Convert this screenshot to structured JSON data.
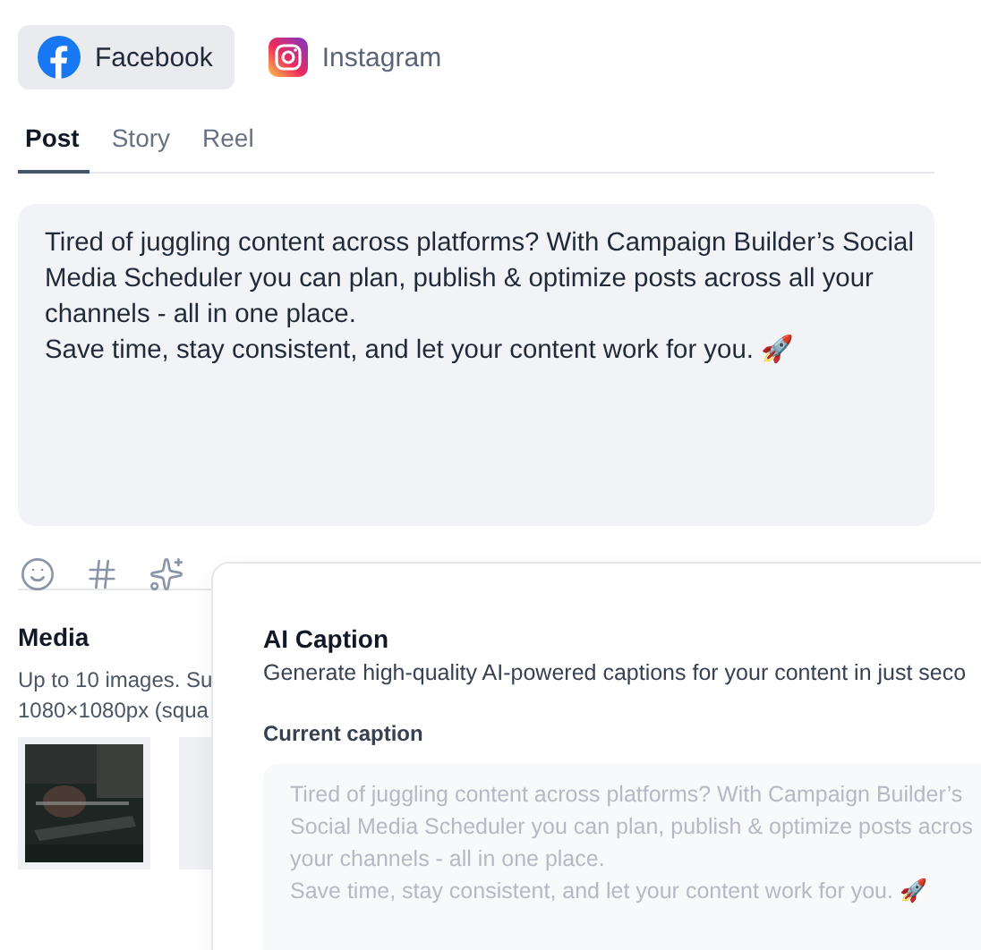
{
  "platforms": [
    {
      "kind": "facebook",
      "label": "Facebook",
      "selected": true
    },
    {
      "kind": "instagram",
      "label": "Instagram",
      "selected": false
    }
  ],
  "tabs": [
    {
      "label": "Post",
      "selected": true
    },
    {
      "label": "Story",
      "selected": false
    },
    {
      "label": "Reel",
      "selected": false
    }
  ],
  "post_text": "Tired of juggling content across platforms? With Campaign Builder’s Social Media Scheduler you can plan, publish & optimize posts across all your channels - all in one place.\nSave time, stay consistent, and let your content work for you. 🚀",
  "toolbar": [
    {
      "kind": "emoji"
    },
    {
      "kind": "hashtag"
    },
    {
      "kind": "ai"
    }
  ],
  "media": {
    "title": "Media",
    "description_lines": [
      "Up to 10 images. Su",
      "1080×1080px (squa"
    ],
    "items": [
      {
        "kind": "picture"
      },
      {
        "kind": "placeholder"
      }
    ]
  },
  "ai_caption": {
    "title": "AI Caption",
    "subtitle": "Generate high-quality AI-powered captions for your content in just seco",
    "label": "Current caption",
    "caption_lines": [
      "Tired of juggling content across platforms? With Campaign Builder’s",
      "Social Media Scheduler you can plan, publish & optimize posts acros",
      "your channels - all in one place.",
      "Save time, stay consistent, and let your content work for you. 🚀"
    ]
  }
}
